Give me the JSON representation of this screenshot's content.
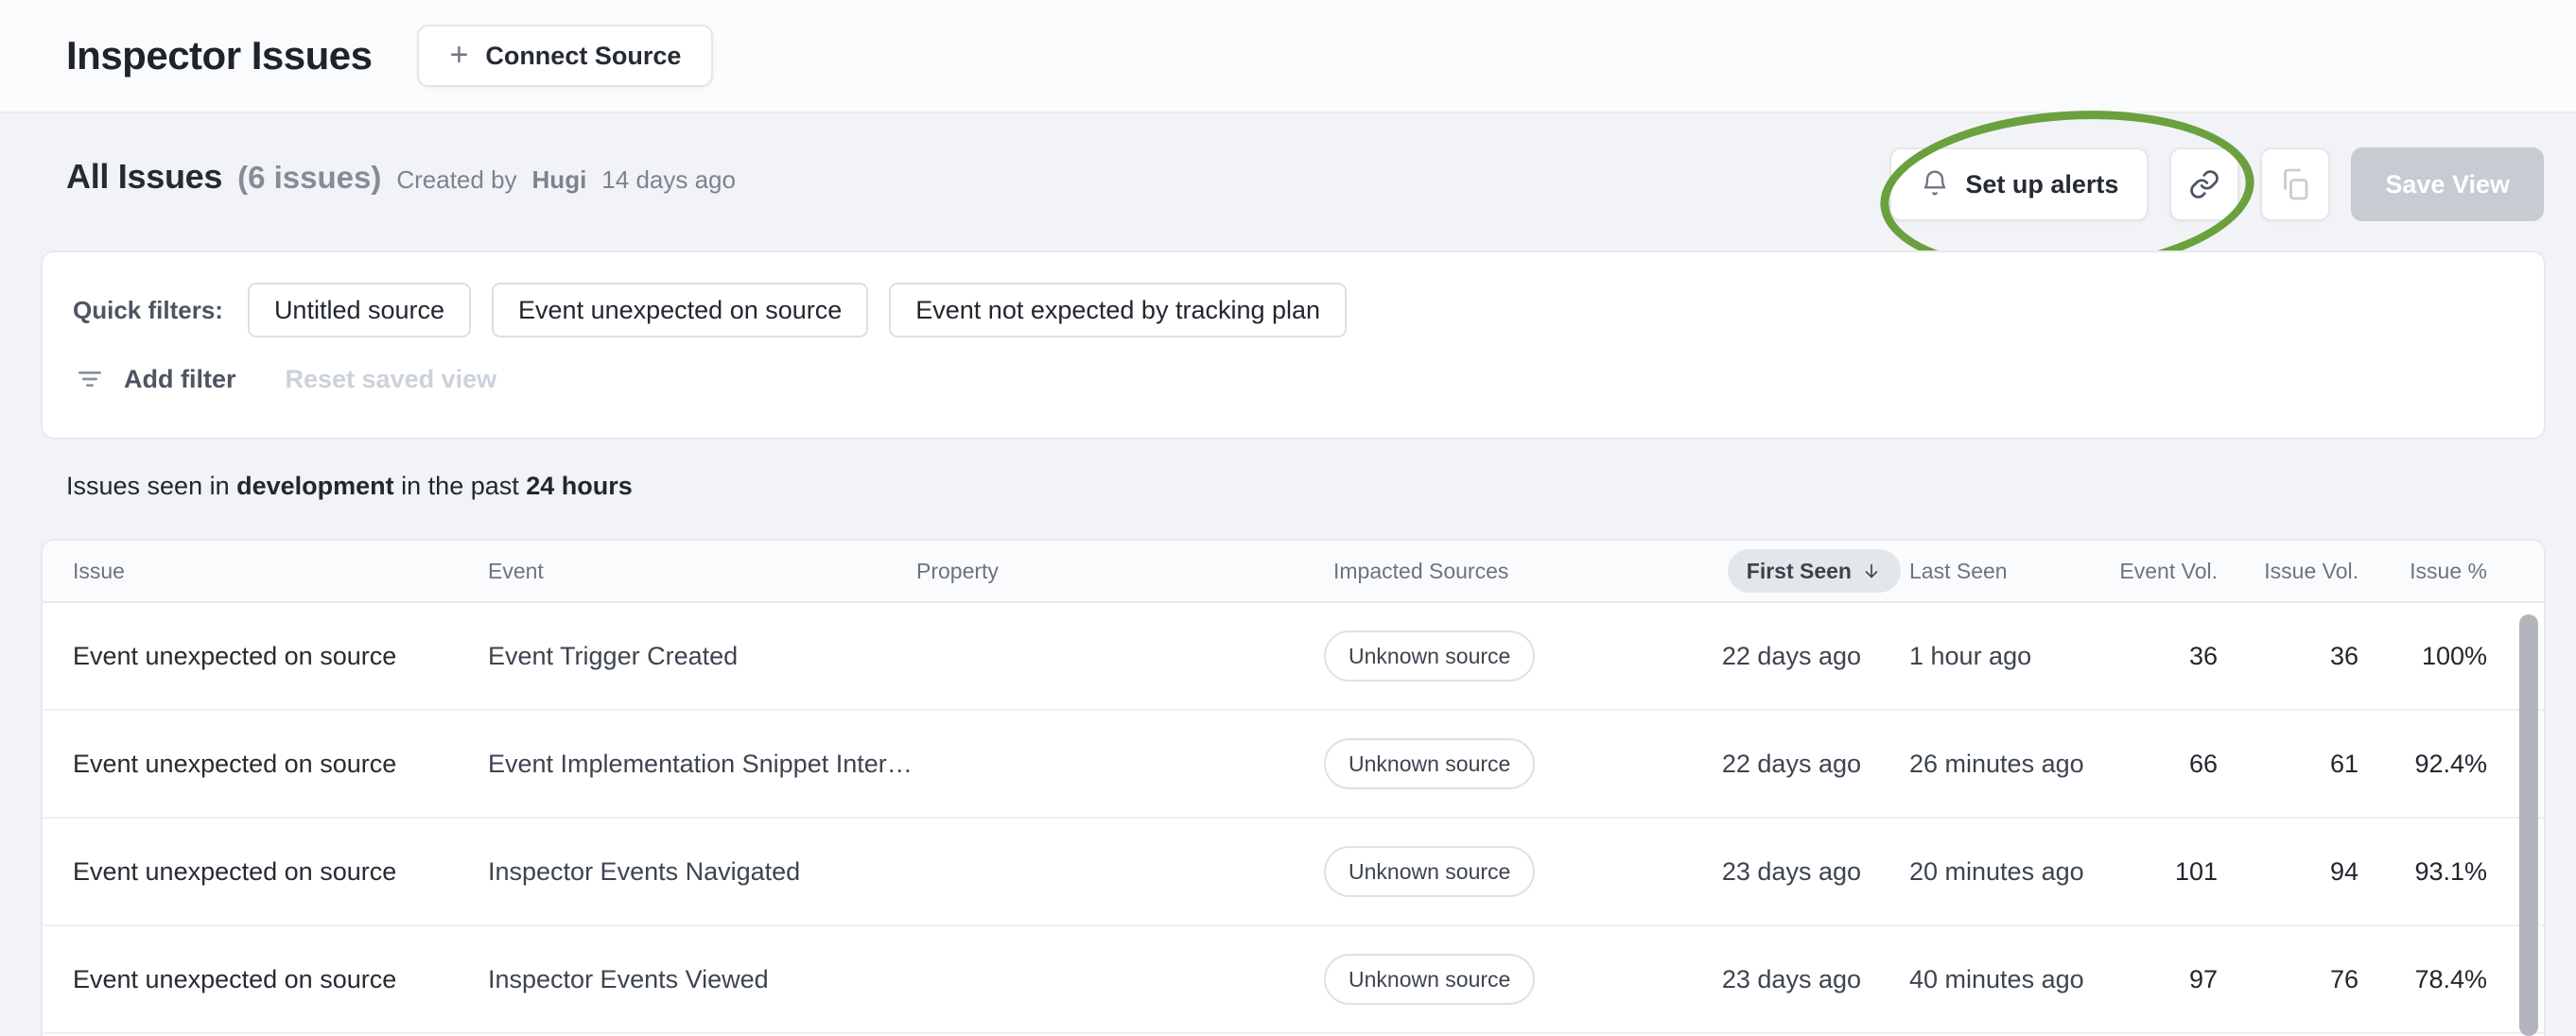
{
  "header": {
    "title": "Inspector Issues",
    "plus": "+",
    "connect_source_label": "Connect Source"
  },
  "view_bar": {
    "title": "All Issues",
    "count": "(6 issues)",
    "created_prefix": "Created by",
    "created_user": "Hugi",
    "created_ago": "14 days ago",
    "setup_alerts_label": "Set up alerts",
    "save_view_label": "Save View"
  },
  "filters": {
    "quick_filters_label": "Quick filters:",
    "chips": [
      "Untitled source",
      "Event unexpected on source",
      "Event not expected by tracking plan"
    ],
    "add_filter_label": "Add filter",
    "reset_label": "Reset saved view"
  },
  "scope": {
    "prefix": "Issues seen in ",
    "env": "development",
    "middle": " in the past ",
    "range": "24 hours"
  },
  "table": {
    "columns": [
      "Issue",
      "Event",
      "Property",
      "Impacted Sources",
      "First Seen",
      "Last Seen",
      "Event Vol.",
      "Issue Vol.",
      "Issue %"
    ],
    "sorted_column": "First Seen",
    "sort_direction": "descending",
    "rows": [
      {
        "issue": "Event unexpected on source",
        "event": "Event Trigger Created",
        "property": "",
        "impacted_source": "Unknown source",
        "first_seen": "22 days ago",
        "last_seen": "1 hour ago",
        "event_vol": "36",
        "issue_vol": "36",
        "issue_pct": "100%"
      },
      {
        "issue": "Event unexpected on source",
        "event": "Event Implementation Snippet Inter…",
        "property": "",
        "impacted_source": "Unknown source",
        "first_seen": "22 days ago",
        "last_seen": "26 minutes ago",
        "event_vol": "66",
        "issue_vol": "61",
        "issue_pct": "92.4%"
      },
      {
        "issue": "Event unexpected on source",
        "event": "Inspector Events Navigated",
        "property": "",
        "impacted_source": "Unknown source",
        "first_seen": "23 days ago",
        "last_seen": "20 minutes ago",
        "event_vol": "101",
        "issue_vol": "94",
        "issue_pct": "93.1%"
      },
      {
        "issue": "Event unexpected on source",
        "event": "Inspector Events Viewed",
        "property": "",
        "impacted_source": "Unknown source",
        "first_seen": "23 days ago",
        "last_seen": "40 minutes ago",
        "event_vol": "97",
        "issue_vol": "76",
        "issue_pct": "78.4%"
      }
    ]
  },
  "icons": {
    "bell": "bell-icon",
    "link": "link-icon",
    "copy": "copy-icon",
    "filter": "filter-icon",
    "sort_down": "arrow-down-icon"
  },
  "colors": {
    "annotation_green": "#6aa13e",
    "page_background": "#f1f3f6",
    "topbar_background": "#fafbfc",
    "disabled_button": "#c7cbd2",
    "sort_pill_background": "#e4e7ea",
    "text_dark": "#262b33",
    "text_gray": "#6d7480"
  }
}
